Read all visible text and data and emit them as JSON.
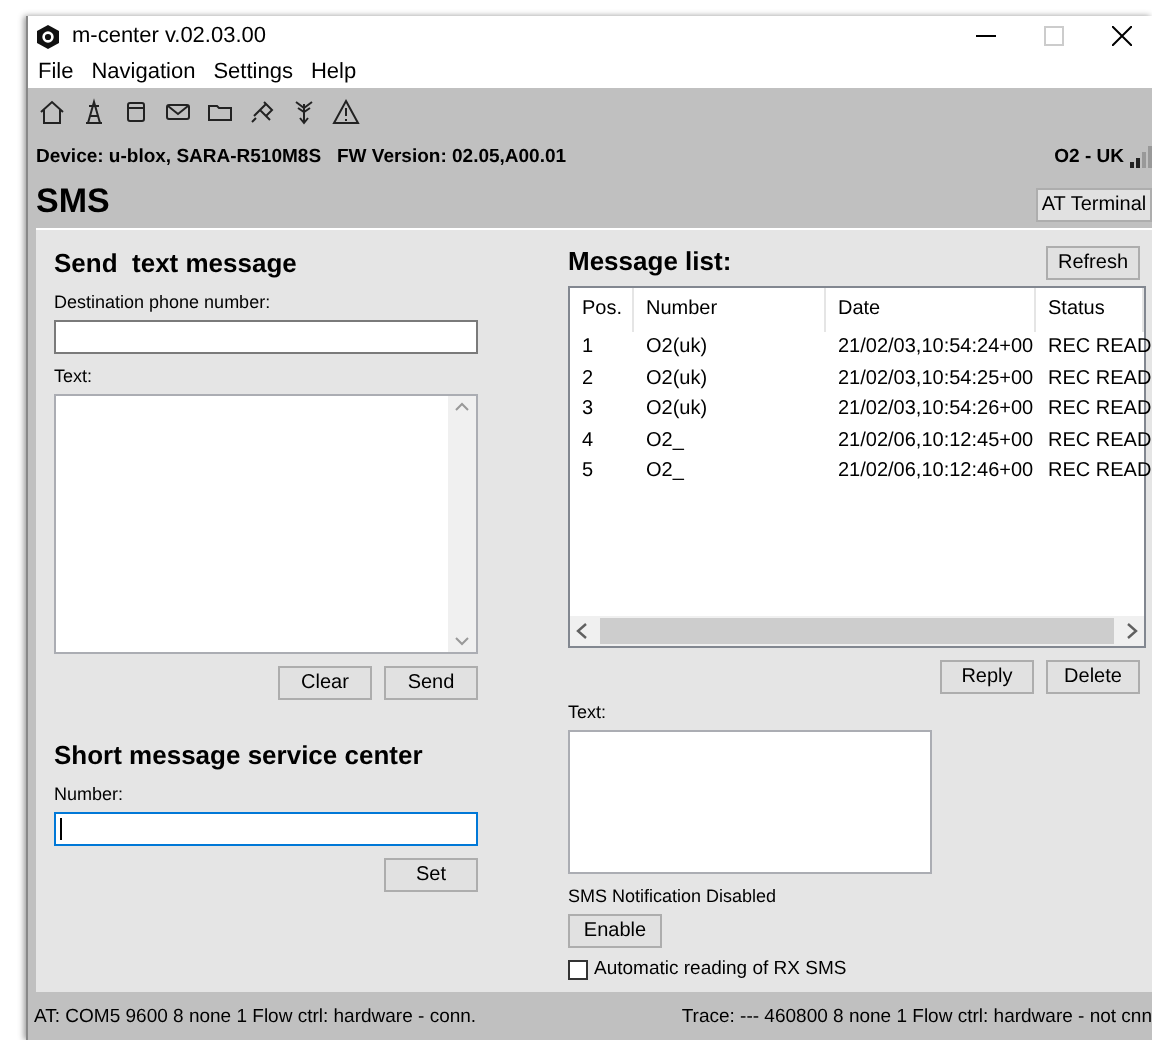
{
  "window": {
    "title": "m-center v.02.03.00"
  },
  "menu": [
    "File",
    "Navigation",
    "Settings",
    "Help"
  ],
  "device_info": {
    "device": "Device: u-blox, SARA-R510M8S",
    "firmware": "FW Version: 02.05,A00.01",
    "operator": "O2 - UK"
  },
  "page": {
    "title": "SMS",
    "terminal_button": "AT Terminal"
  },
  "send": {
    "title": "Send  text message",
    "destination_label": "Destination phone number:",
    "text_label": "Text:",
    "buttons": [
      "Clear",
      "Send"
    ]
  },
  "smsc": {
    "title": "Short message service center",
    "number_label": "Number:",
    "focused": true,
    "button": "Set"
  },
  "messages": {
    "title": "Message list:",
    "refresh": "Refresh",
    "columns": [
      "Pos.",
      "Number",
      "Date",
      "Status"
    ],
    "rows": [
      [
        "1",
        "O2(uk)",
        "21/02/03,10:54:24+00",
        "REC READ"
      ],
      [
        "2",
        "O2(uk)",
        "21/02/03,10:54:25+00",
        "REC READ"
      ],
      [
        "3",
        "O2(uk)",
        "21/02/03,10:54:26+00",
        "REC READ"
      ],
      [
        "4",
        "O2_",
        "21/02/06,10:12:45+00",
        "REC READ"
      ],
      [
        "5",
        "O2_",
        "21/02/06,10:12:46+00",
        "REC READ"
      ]
    ],
    "buttons": [
      "Reply",
      "Delete"
    ],
    "text_label": "Text:",
    "notification": "SMS Notification Disabled",
    "enable": "Enable",
    "auto_read": {
      "label": "Automatic reading of RX SMS",
      "checked": false
    }
  },
  "status_bar": {
    "at": "AT: COM5 9600 8 none 1 Flow ctrl: hardware - conn.",
    "trace": "Trace: --- 460800 8 none 1 Flow ctrl: hardware - not cnn"
  }
}
